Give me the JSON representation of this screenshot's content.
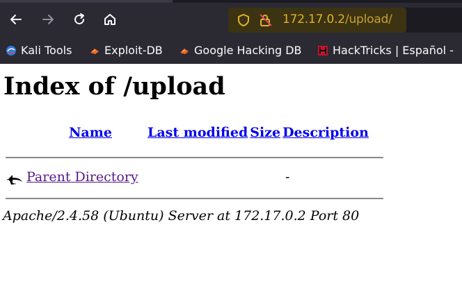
{
  "browser": {
    "url_host": "172.17.0.2",
    "url_path": "/upload/",
    "bookmarks": [
      {
        "label": "Kali Tools",
        "icon": "kali-icon"
      },
      {
        "label": "Exploit-DB",
        "icon": "exploit-db-icon"
      },
      {
        "label": "Google Hacking DB",
        "icon": "ghdb-icon"
      },
      {
        "label": "HackTricks | Español -",
        "icon": "hacktricks-icon"
      }
    ]
  },
  "page": {
    "title": "Index of /upload",
    "columns": {
      "name": "Name",
      "last_modified": "Last modified",
      "size": "Size",
      "description": "Description"
    },
    "rows": [
      {
        "name": "Parent Directory",
        "last_modified": "",
        "size": "-",
        "description": "",
        "icon": "back-arrow-icon"
      }
    ],
    "server_signature": "Apache/2.4.58 (Ubuntu) Server at 172.17.0.2 Port 80"
  },
  "colors": {
    "chrome_bg": "#2b2a33",
    "url_text": "#e3b12a",
    "link": "#0000ee",
    "visited_link": "#551a8b"
  }
}
